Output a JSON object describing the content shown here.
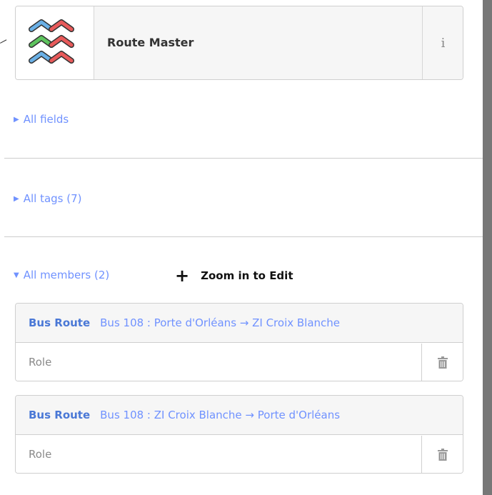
{
  "preset": {
    "name": "Route Master",
    "icon": "route-master-icon",
    "info_label": "i"
  },
  "sections": {
    "fields": {
      "label": "All fields",
      "expanded": false
    },
    "tags": {
      "label": "All tags (7)",
      "expanded": false
    },
    "members": {
      "label": "All members (2)",
      "expanded": true
    }
  },
  "zoom_to_edit": {
    "plus_label": "+",
    "label": "Zoom in to Edit"
  },
  "members": [
    {
      "type": "Bus Route",
      "name": "Bus 108 : Porte d'Orléans → ZI Croix Blanche",
      "role_placeholder": "Role",
      "role_value": ""
    },
    {
      "type": "Bus Route",
      "name": "Bus 108 : ZI Croix Blanche → Porte d'Orléans",
      "role_placeholder": "Role",
      "role_value": ""
    }
  ],
  "colors": {
    "link": "#7092ff",
    "member_type": "#4a78d6",
    "header_bg": "#f6f6f6",
    "border": "#cfcfcf",
    "scrollbar": "#777777"
  }
}
